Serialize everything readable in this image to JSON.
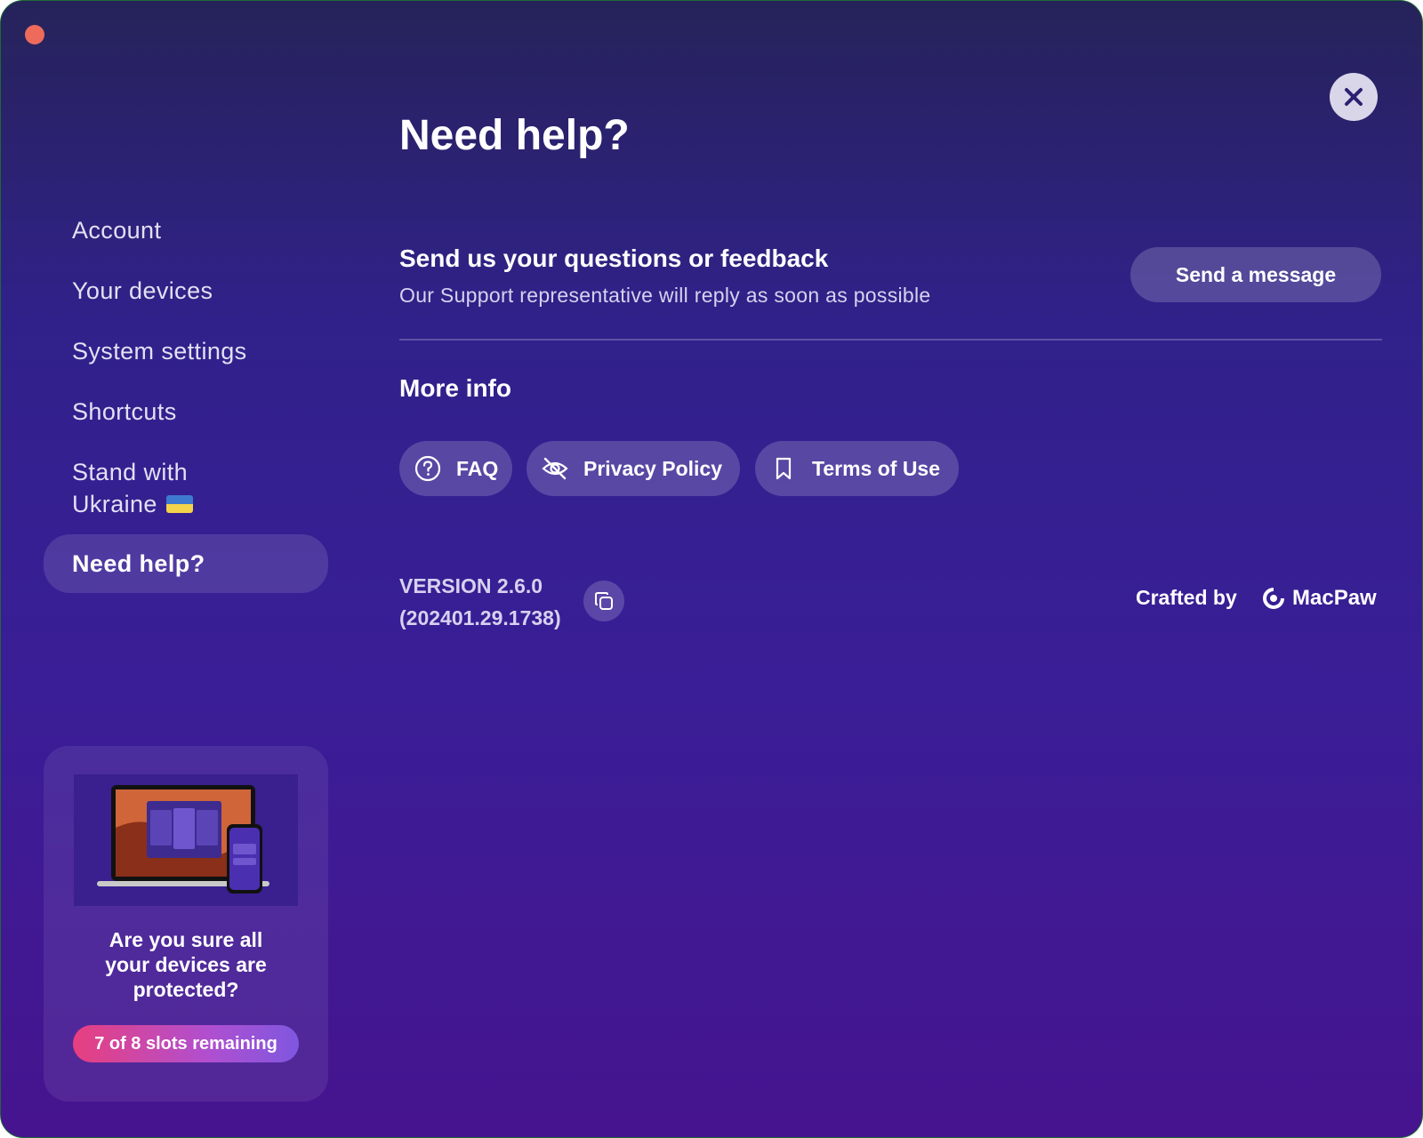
{
  "window": {
    "traffic_light_color": "#ee6a5b",
    "close_icon": "close-icon"
  },
  "sidebar": {
    "items": [
      {
        "label": "Account"
      },
      {
        "label": "Your devices"
      },
      {
        "label": "System settings"
      },
      {
        "label": "Shortcuts"
      },
      {
        "label_line1": "Stand with",
        "label_line2": "Ukraine",
        "flag": "ukraine-flag-icon"
      },
      {
        "label": "Need help?",
        "active": true
      }
    ]
  },
  "promo": {
    "image": "devices-illustration",
    "text": "Are you sure all your devices are protected?",
    "slots_label": "7 of 8 slots remaining"
  },
  "main": {
    "title": "Need help?",
    "feedback": {
      "title": "Send us your questions or feedback",
      "subtitle": "Our Support representative will reply as soon as possible",
      "button_label": "Send a message"
    },
    "more_info": {
      "title": "More info",
      "links": [
        {
          "label": "FAQ",
          "icon": "question-circle-icon"
        },
        {
          "label": "Privacy Policy",
          "icon": "eye-slash-icon"
        },
        {
          "label": "Terms of Use",
          "icon": "bookmark-icon"
        }
      ]
    },
    "version": {
      "line1": "VERSION 2.6.0",
      "line2": "(202401.29.1738)",
      "copy_icon": "copy-icon"
    },
    "credits": {
      "crafted_by": "Crafted by",
      "brand": "MacPaw"
    }
  },
  "colors": {
    "bg_top": "#26235a",
    "bg_bottom": "#46148f",
    "pill_gradient_start": "#e83f7f",
    "pill_gradient_end": "#7f57df"
  }
}
